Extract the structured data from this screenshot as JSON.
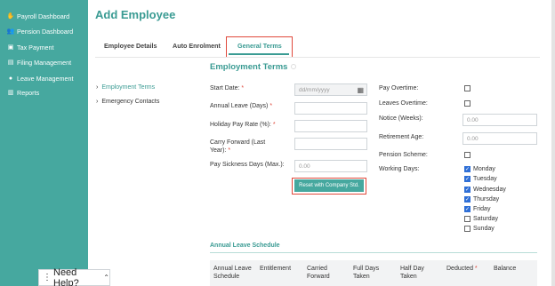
{
  "sidebar": {
    "items": [
      {
        "label": "Payroll Dashboard",
        "icon": "hand-coin-icon"
      },
      {
        "label": "Pension Dashboard",
        "icon": "people-icon"
      },
      {
        "label": "Tax Payment",
        "icon": "wallet-icon"
      },
      {
        "label": "Filing Management",
        "icon": "document-icon"
      },
      {
        "label": "Leave Management",
        "icon": "globe-icon"
      },
      {
        "label": "Reports",
        "icon": "report-icon"
      }
    ]
  },
  "header": {
    "title": "Add Employee"
  },
  "tabs": [
    {
      "label": "Employee Details"
    },
    {
      "label": "Auto Enrolment"
    },
    {
      "label": "General Terms"
    }
  ],
  "left_nav": [
    {
      "label": "Employment Terms"
    },
    {
      "label": "Emergency Contacts"
    }
  ],
  "section": {
    "title": "Employment Terms"
  },
  "form": {
    "start_date": {
      "label": "Start Date:",
      "placeholder": "dd/mm/yyyy"
    },
    "annual_leave": {
      "label": "Annual Leave (Days)"
    },
    "holiday_pay": {
      "label": "Holiday Pay Rate (%):"
    },
    "carry_forward": {
      "label_line1": "Carry Forward (Last",
      "label_line2": "Year):"
    },
    "pay_sickness": {
      "label": "Pay Sickness Days (Max.):",
      "value": "0.00"
    },
    "reset_button": "Reset with Company Std.",
    "pay_overtime": {
      "label": "Pay Overtime:"
    },
    "leaves_overtime": {
      "label": "Leaves Overtime:"
    },
    "notice_weeks": {
      "label": "Notice (Weeks):",
      "value": "0.00"
    },
    "retirement_age": {
      "label": "Retirement Age:",
      "value": "0.00"
    },
    "pension_scheme": {
      "label": "Pension Scheme:"
    },
    "working_days": {
      "label": "Working Days:",
      "days": [
        {
          "name": "Monday",
          "checked": true
        },
        {
          "name": "Tuesday",
          "checked": true
        },
        {
          "name": "Wednesday",
          "checked": true
        },
        {
          "name": "Thursday",
          "checked": true
        },
        {
          "name": "Friday",
          "checked": true
        },
        {
          "name": "Saturday",
          "checked": false
        },
        {
          "name": "Sunday",
          "checked": false
        }
      ]
    }
  },
  "schedule": {
    "title": "Annual Leave Schedule",
    "columns": [
      {
        "line1": "Annual Leave",
        "line2": "Schedule"
      },
      {
        "line1": "Entitlement",
        "line2": ""
      },
      {
        "line1": "Carried",
        "line2": "Forward"
      },
      {
        "line1": "Full Days",
        "line2": "Taken"
      },
      {
        "line1": "Half Day",
        "line2": "Taken"
      },
      {
        "line1": "Deducted",
        "line2": ""
      },
      {
        "line1": "Balance",
        "line2": ""
      }
    ]
  },
  "help": {
    "label": "Need Help?"
  },
  "colors": {
    "accent": "#46a89f",
    "highlight": "#e0493c",
    "checkbox": "#2f6fd6"
  }
}
